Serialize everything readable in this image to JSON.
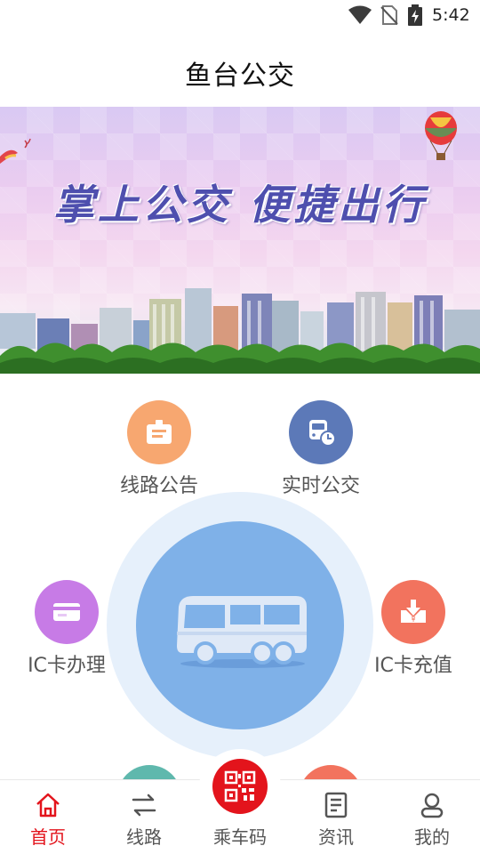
{
  "status_bar": {
    "time": "5:42"
  },
  "header": {
    "title": "鱼台公交"
  },
  "banner": {
    "slogan": "掌上公交  便捷出行"
  },
  "features": {
    "route_notice": {
      "label": "线路公告",
      "color": "#f7a770"
    },
    "realtime_bus": {
      "label": "实时公交",
      "color": "#5c79b8"
    },
    "ic_card_apply": {
      "label": "IC卡办理",
      "color": "#c77be6"
    },
    "ic_card_recharge": {
      "label": "IC卡充值",
      "color": "#f2735e"
    }
  },
  "center": {
    "icon": "bus-icon",
    "halo_color": "#e6f0fb",
    "core_color": "#7fb1e8"
  },
  "tab_bar": {
    "accent": "#e3141c",
    "tabs": [
      {
        "label": "首页",
        "icon": "home-icon",
        "active": true
      },
      {
        "label": "线路",
        "icon": "route-arrows-icon",
        "active": false
      },
      {
        "label": "乘车码",
        "icon": "qr-code-icon",
        "active": false
      },
      {
        "label": "资讯",
        "icon": "news-icon",
        "active": false
      },
      {
        "label": "我的",
        "icon": "profile-icon",
        "active": false
      }
    ]
  }
}
